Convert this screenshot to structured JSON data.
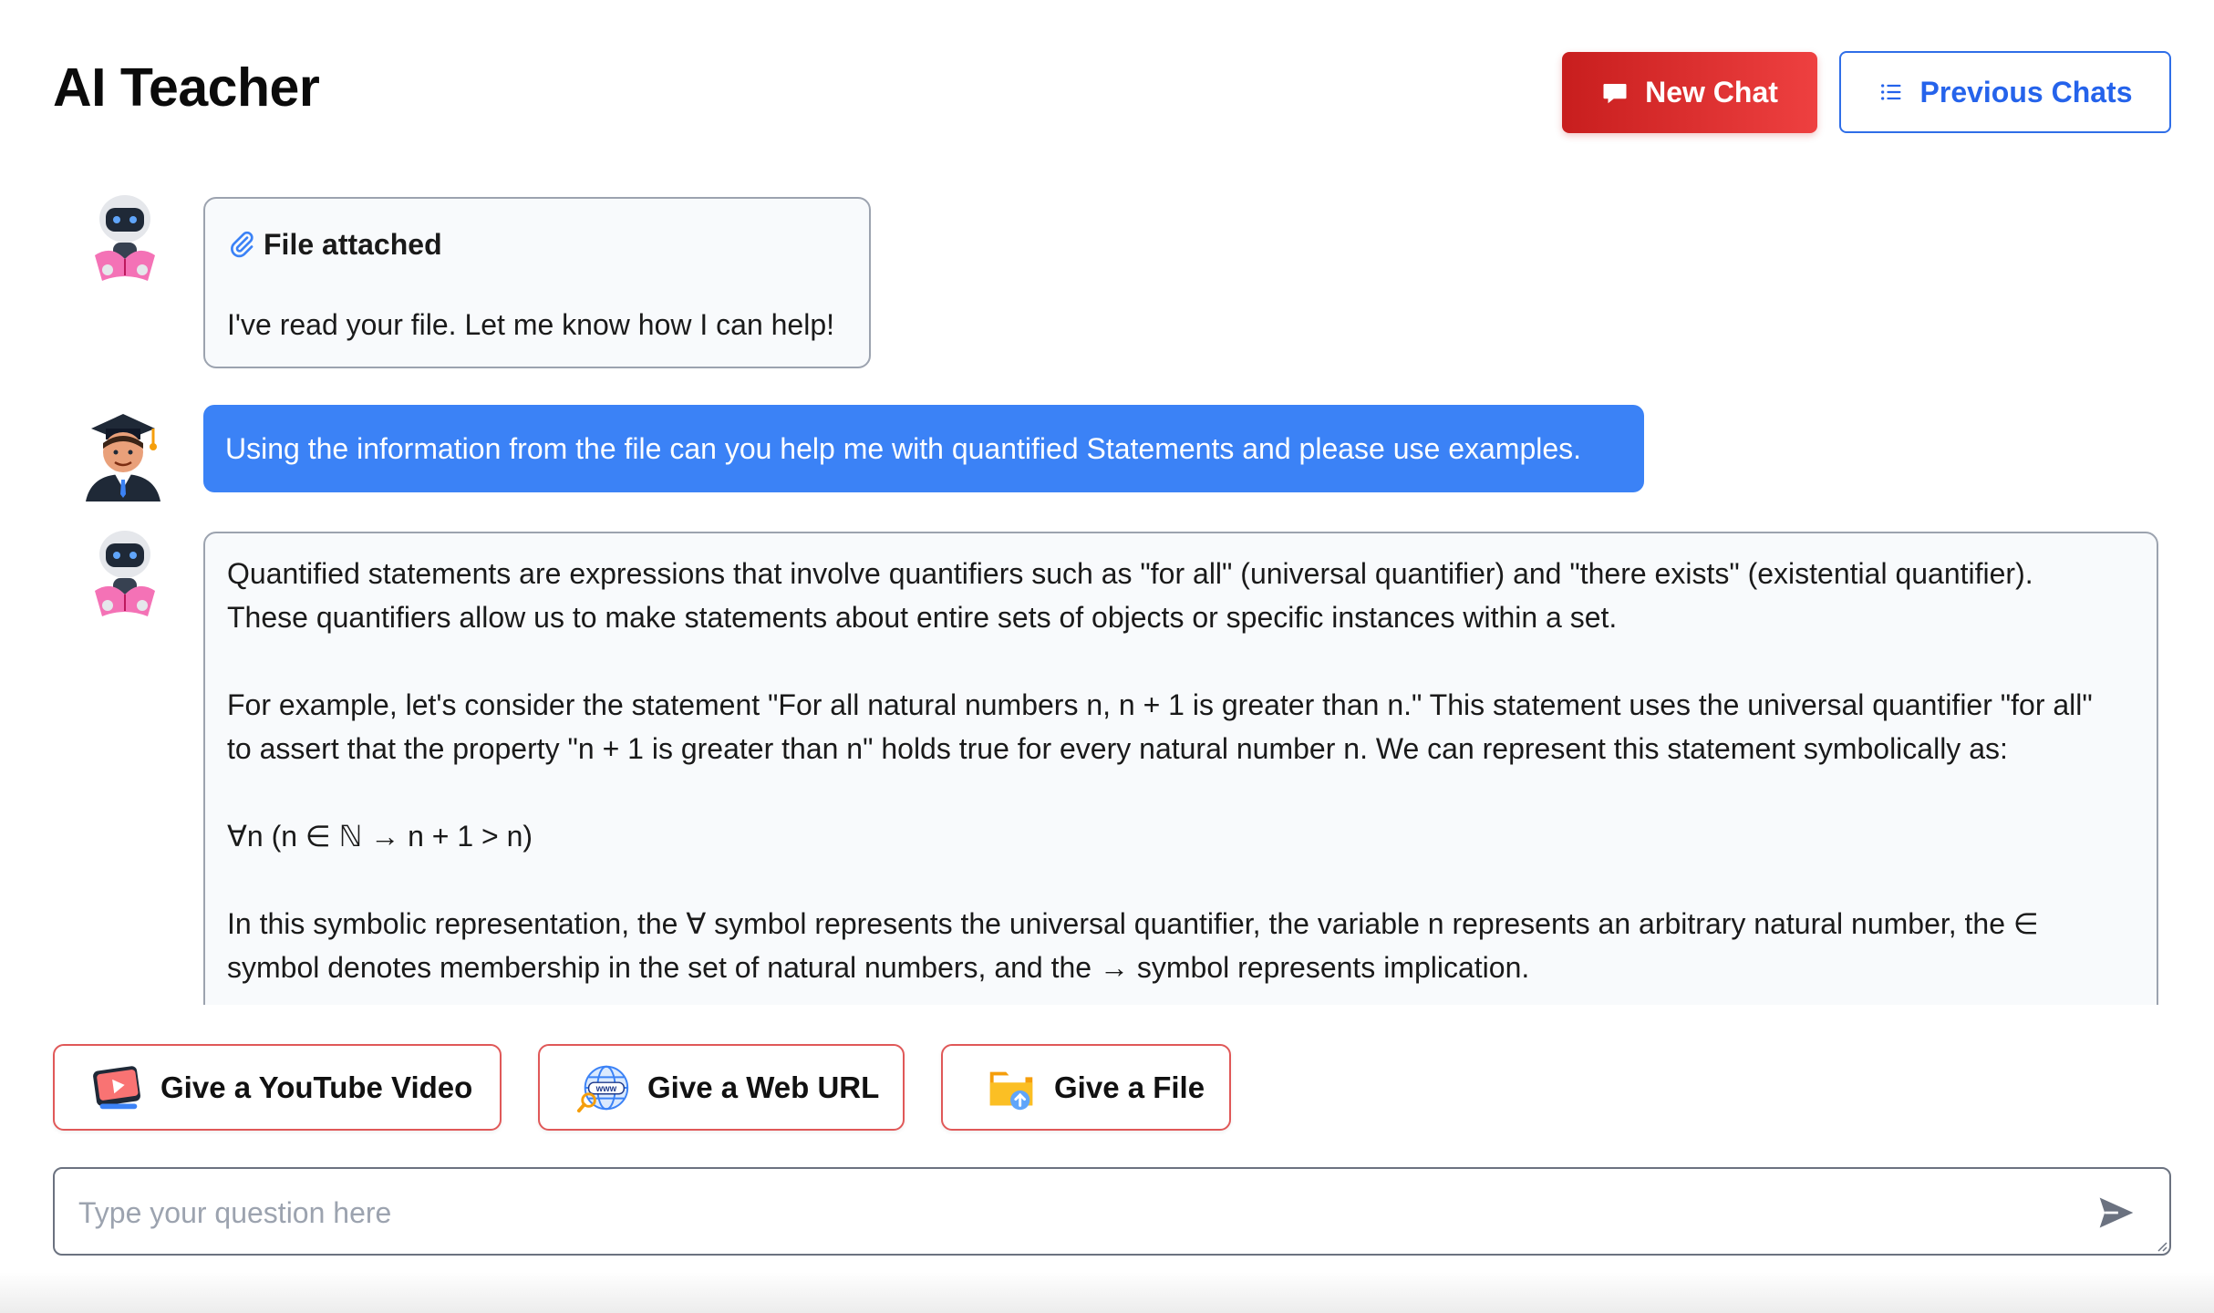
{
  "app": {
    "title": "AI Teacher"
  },
  "header": {
    "new_chat_label": "New Chat",
    "previous_chats_label": "Previous Chats"
  },
  "messages": [
    {
      "role": "bot",
      "title": "File attached",
      "text": "I've read your file. Let me know how I can help!"
    },
    {
      "role": "user",
      "text": "Using the information from the file can you help me with quantified Statements and please use examples."
    },
    {
      "role": "bot",
      "paragraphs": [
        "Quantified statements are expressions that involve quantifiers such as \"for all\" (universal quantifier) and \"there exists\" (existential quantifier). These quantifiers allow us to make statements about entire sets of objects or specific instances within a set.",
        "For example, let's consider the statement \"For all natural numbers n, n + 1 is greater than n.\" This statement uses the universal quantifier \"for all\" to assert that the property \"n + 1 is greater than n\" holds true for every natural number n. We can represent this statement symbolically as:",
        "∀n (n ∈ ℕ → n + 1 > n)",
        "In this symbolic representation, the ∀ symbol represents the universal quantifier, the variable n represents an arbitrary natural number, the ∈ symbol denotes membership in the set of natural numbers, and the → symbol represents implication."
      ]
    }
  ],
  "quick_actions": {
    "youtube_label": "Give a YouTube Video",
    "web_url_label": "Give a Web URL",
    "file_label": "Give a File"
  },
  "composer": {
    "placeholder": "Type your question here",
    "value": ""
  },
  "colors": {
    "accent_red": "#dc2626",
    "accent_blue": "#2563eb",
    "user_bubble": "#3b82f6"
  }
}
